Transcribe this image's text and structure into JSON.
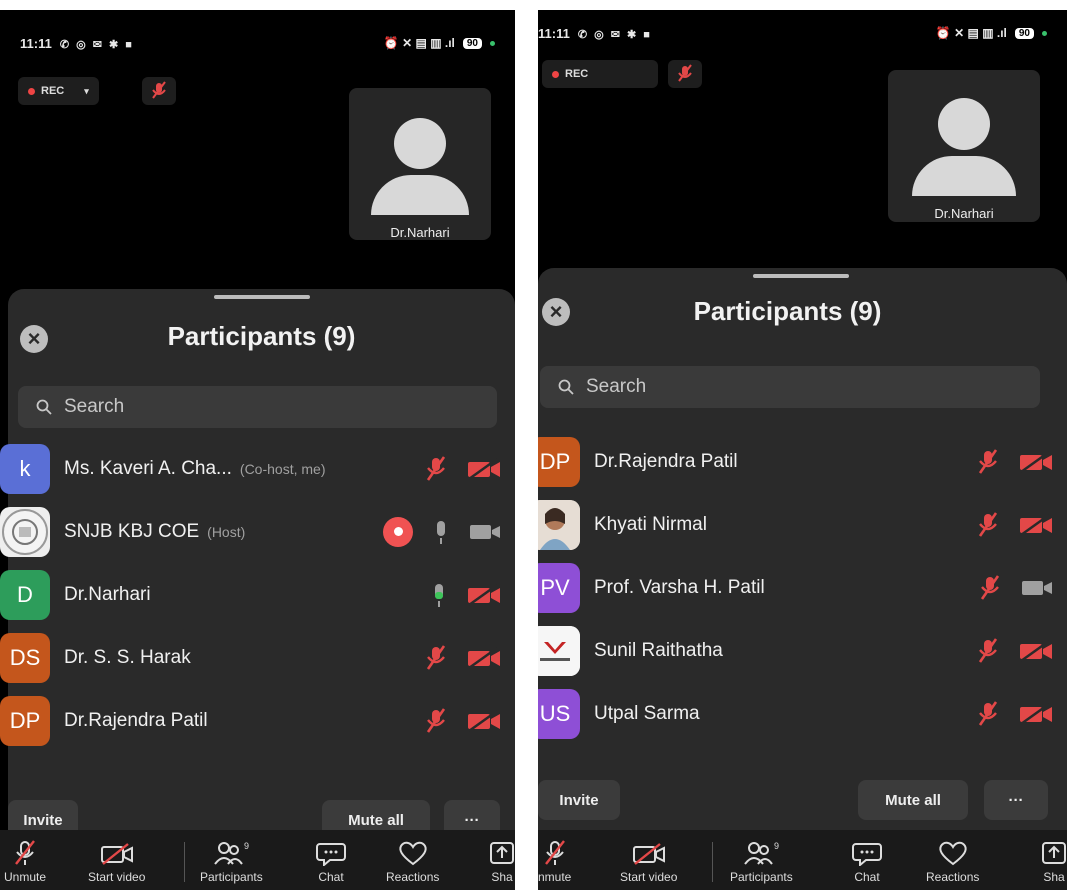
{
  "status": {
    "time": "11:11",
    "left_icons": "✆ ◎ ✉ ✱ ■",
    "right_icons": "⏰ ✕ ▤ ▥ .ıl",
    "battery": "90"
  },
  "rec_label": "REC",
  "video_tile": {
    "name": "Dr.Narhari"
  },
  "participants_title": "Participants (9)",
  "search": {
    "placeholder": "Search"
  },
  "left_participants": [
    {
      "initials": "k",
      "name": "Ms. Kaveri A. Cha...",
      "role": "(Co-host, me)",
      "color": "#5a6fd6"
    },
    {
      "name": "SNJB KBJ COE",
      "role": "(Host)"
    },
    {
      "initials": "D",
      "name": "Dr.Narhari",
      "color": "#2d9d5b"
    },
    {
      "initials": "DS",
      "name": "Dr. S. S. Harak",
      "color": "#c4561c"
    },
    {
      "initials": "DP",
      "name": "Dr.Rajendra Patil",
      "color": "#c4561c"
    }
  ],
  "right_participants": [
    {
      "initials": "DP",
      "name": "Dr.Rajendra Patil",
      "color": "#c4561c"
    },
    {
      "name": "Khyati Nirmal"
    },
    {
      "initials": "PV",
      "name": "Prof. Varsha H. Patil",
      "color": "#8e4fd6"
    },
    {
      "name": "Sunil Raithatha"
    },
    {
      "initials": "US",
      "name": "Utpal Sarma",
      "color": "#8e4fd6"
    }
  ],
  "actions": {
    "invite": "Invite",
    "mute_all": "Mute all",
    "more": "···"
  },
  "toolbar": {
    "unmute": "Unmute",
    "unmute_cut": "nmute",
    "start_video": "Start video",
    "participants": "Participants",
    "participants_count": "9",
    "chat": "Chat",
    "reactions": "Reactions",
    "share_cut": "Sha"
  },
  "colors": {
    "muted_red": "#e34848",
    "mic_green": "#3ec45a",
    "gray_icon": "#a0a0a0"
  }
}
